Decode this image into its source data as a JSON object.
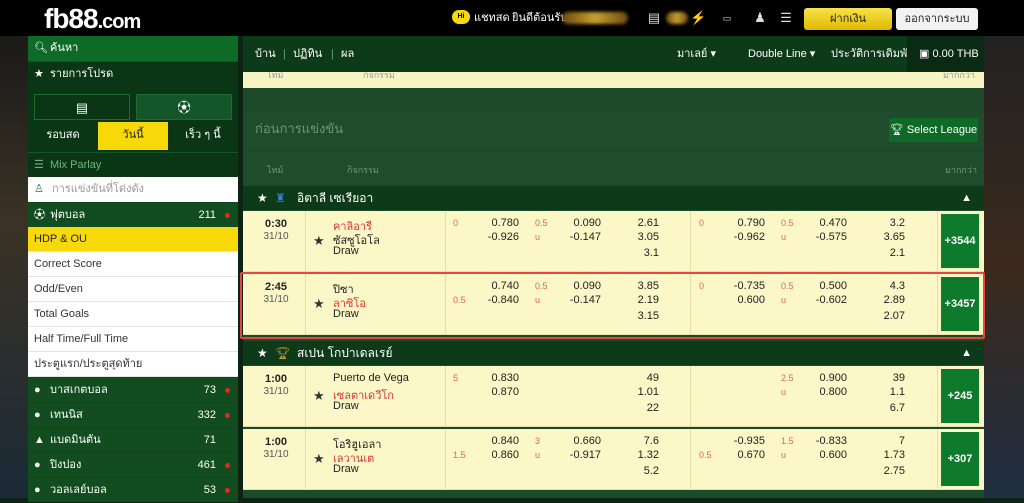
{
  "header": {
    "logo_main": "fb88",
    "logo_suffix": ".com",
    "chat_badge": "Hi",
    "chat_label": "แชทสด",
    "welcome": "ยินดีต้อนรับ",
    "deposit": "ฝากเงิน",
    "logout": "ออกจากระบบ"
  },
  "sidebar": {
    "search": "ค้นหา",
    "favorites": "รายการโปรด",
    "tabs": [
      "รอบสด",
      "วันนี้",
      "เร็ว ๆ นี้"
    ],
    "mix": "Mix Parlay",
    "league_search": "การแข่งขันที่โด่งดัง",
    "football": {
      "label": "ฟุตบอล",
      "count": "211"
    },
    "subs": [
      "HDP & OU",
      "Correct Score",
      "Odd/Even",
      "Total Goals",
      "Half Time/Full Time",
      "ประตูแรก/ประตูสุดท้าย"
    ],
    "sports": [
      {
        "label": "บาสเกตบอล",
        "count": "73"
      },
      {
        "label": "เทนนิส",
        "count": "332"
      },
      {
        "label": "แบดมินตัน",
        "count": "71"
      },
      {
        "label": "ปิงปอง",
        "count": "461"
      },
      {
        "label": "วอลเลย์บอล",
        "count": "53"
      }
    ]
  },
  "nav": {
    "home": "บ้าน",
    "calendar": "ปฏิทิน",
    "results": "ผล",
    "market": "มาเลย์",
    "line": "Double Line",
    "history": "ประวัติการเดิมพัน",
    "balance": "0.00 THB"
  },
  "main": {
    "prev_time": "ไทม์",
    "prev_event": "กิจกรรม",
    "prev_more": "มากกว่า",
    "section_title": "ก่อนการแข่งขัน",
    "select_league": "Select League",
    "col_time": "ไทม์",
    "col_event": "กิจกรรม",
    "col_more": "มากกว่า",
    "leagues": [
      {
        "name": "อิตาลี เซเรียอา"
      },
      {
        "name": "สเปน โกปาเดลเรย์"
      }
    ],
    "matches": [
      {
        "time": "0:30",
        "date": "31/10",
        "home": "คาลิอารี",
        "away": "ซัสซูโอโล",
        "draw": "Draw",
        "a_hdp": "0",
        "a_hdp_h": "0.780",
        "a_hdp_a": "-0.926",
        "a_ou": "0.5",
        "a_u": "u",
        "a_ou_h": "0.090",
        "a_ou_a": "-0.147",
        "a_1": "2.61",
        "a_2": "3.05",
        "a_x": "3.1",
        "b_hdp": "0",
        "b_hdp_h": "0.790",
        "b_hdp_a": "-0.962",
        "b_ou": "0.5",
        "b_u": "u",
        "b_ou_h": "0.470",
        "b_ou_a": "-0.575",
        "b_1": "3.2",
        "b_2": "3.65",
        "b_x": "2.1",
        "more": "+3544"
      },
      {
        "time": "2:45",
        "date": "31/10",
        "home": "ปิซา",
        "away": "ลาซิโอ",
        "draw": "Draw",
        "a_hdp": "0.5",
        "a_hdp_h": "0.740",
        "a_hdp_a": "-0.840",
        "a_ou": "0.5",
        "a_u": "u",
        "a_ou_h": "0.090",
        "a_ou_a": "-0.147",
        "a_1": "3.85",
        "a_2": "2.19",
        "a_x": "3.15",
        "b_hdp": "0",
        "b_hdp_h": "-0.735",
        "b_hdp_a": "0.600",
        "b_ou": "0.5",
        "b_u": "u",
        "b_ou_h": "0.500",
        "b_ou_a": "-0.602",
        "b_1": "4.3",
        "b_2": "2.89",
        "b_x": "2.07",
        "more": "+3457"
      },
      {
        "time": "1:00",
        "date": "31/10",
        "home": "Puerto de Vega",
        "away": "เซลตาเดวีโก",
        "draw": "Draw",
        "a_hdp": "5",
        "a_hdp_h": "0.830",
        "a_hdp_a": "0.870",
        "a_ou": "",
        "a_u": "",
        "a_ou_h": "",
        "a_ou_a": "",
        "a_1": "49",
        "a_2": "1.01",
        "a_x": "22",
        "b_hdp": "",
        "b_hdp_h": "",
        "b_hdp_a": "",
        "b_ou": "2.5",
        "b_u": "u",
        "b_ou_h": "0.900",
        "b_ou_a": "0.800",
        "b_1": "39",
        "b_2": "1.1",
        "b_x": "6.7",
        "more": "+245"
      },
      {
        "time": "1:00",
        "date": "31/10",
        "home": "โอริฮูเอลา",
        "away": "เลวานเต",
        "draw": "Draw",
        "a_hdp": "1.5",
        "a_hdp_h": "0.840",
        "a_hdp_a": "0.860",
        "a_ou": "3",
        "a_u": "u",
        "a_ou_h": "0.660",
        "a_ou_a": "-0.917",
        "a_1": "7.6",
        "a_2": "1.32",
        "a_x": "5.2",
        "b_hdp": "0.5",
        "b_hdp_h": "-0.935",
        "b_hdp_a": "0.670",
        "b_ou": "1.5",
        "b_u": "u",
        "b_ou_h": "-0.833",
        "b_ou_a": "0.600",
        "b_1": "7",
        "b_2": "1.73",
        "b_x": "2.75",
        "more": "+307"
      }
    ]
  }
}
